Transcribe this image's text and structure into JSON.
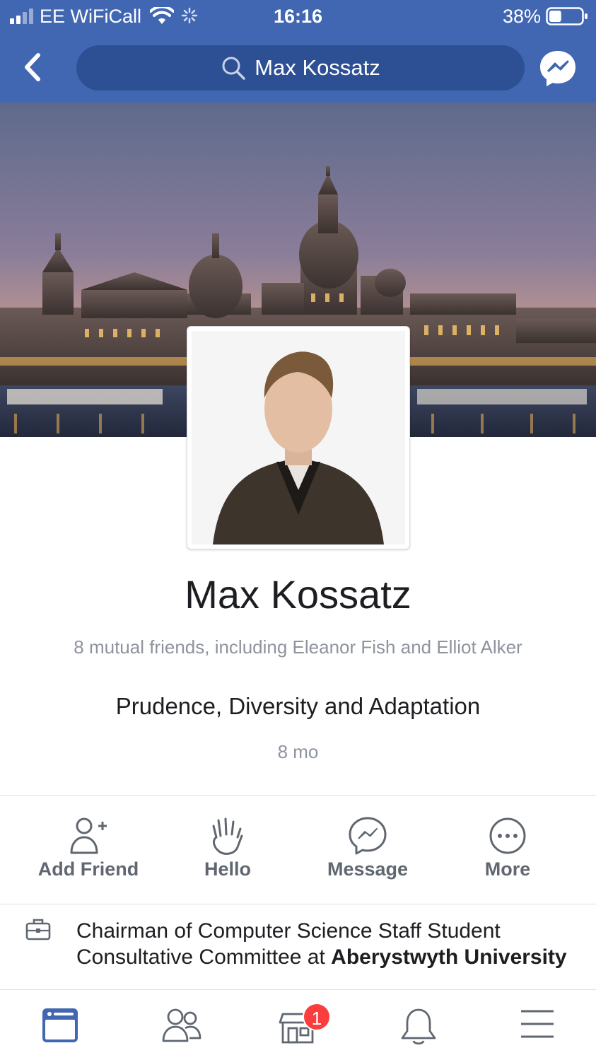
{
  "status_bar": {
    "carrier": "EE WiFiCall",
    "time": "16:16",
    "battery_percent": "38%",
    "battery_level": 0.38,
    "icons": [
      "signal-icon",
      "wifi-icon",
      "activity-spinner-icon",
      "battery-icon"
    ]
  },
  "header": {
    "search_text": "Max Kossatz",
    "icons": [
      "back-chevron-icon",
      "search-icon",
      "messenger-icon"
    ]
  },
  "profile": {
    "name": "Max Kossatz",
    "mutual_friends": "8 mutual friends, including Eleanor Fish and Elliot Alker",
    "bio": "Prudence, Diversity and Adaptation",
    "bio_time": "8 mo"
  },
  "actions": [
    {
      "label": "Add Friend",
      "icon": "add-friend-icon"
    },
    {
      "label": "Hello",
      "icon": "wave-icon"
    },
    {
      "label": "Message",
      "icon": "messenger-icon"
    },
    {
      "label": "More",
      "icon": "more-icon"
    }
  ],
  "work": {
    "text": "Chairman of Computer Science Staff Student Consultative Committee at ",
    "organization": "Aberystwyth University",
    "icon": "briefcase-icon"
  },
  "tab_bar": {
    "tabs": [
      "news-feed-icon",
      "friends-icon",
      "marketplace-icon",
      "notifications-icon",
      "menu-icon"
    ],
    "marketplace_badge": "1"
  },
  "colors": {
    "brand_blue": "#4267b2",
    "search_bg": "#2d4f94",
    "active_tab": "#4267b2",
    "icon_gray": "#606770",
    "muted_text": "#8d949e",
    "badge_red": "#fa3e3e"
  }
}
